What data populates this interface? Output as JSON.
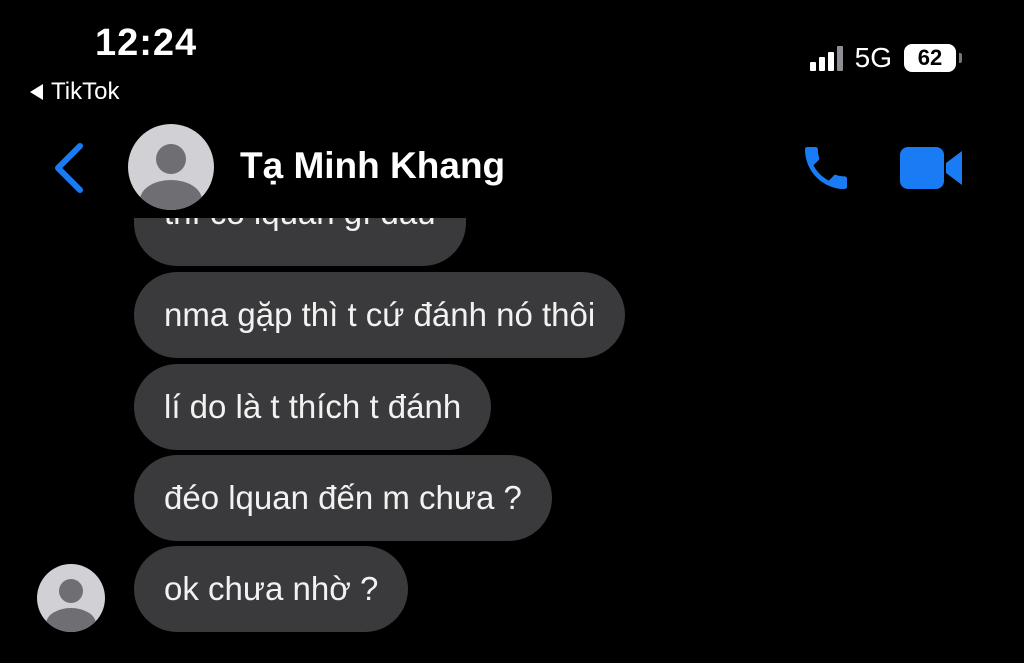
{
  "status_bar": {
    "time": "12:24",
    "back_app_label": "TikTok",
    "network": "5G",
    "battery": "62"
  },
  "header": {
    "contact_name": "Tạ Minh Khang",
    "accent_color": "#1a7cf5"
  },
  "messages": [
    {
      "text": "thì có lquan gì đâu",
      "partially_visible": true
    },
    {
      "text": "nma gặp thì t cứ đánh nó thôi"
    },
    {
      "text": "lí do là t thích t đánh"
    },
    {
      "text": "đéo lquan đến m chưa ?"
    },
    {
      "text": "ok chưa nhờ ?"
    }
  ],
  "icons": [
    "back-chevron-icon",
    "phone-icon",
    "video-camera-icon",
    "signal-icon",
    "battery-icon",
    "avatar-placeholder-icon"
  ]
}
